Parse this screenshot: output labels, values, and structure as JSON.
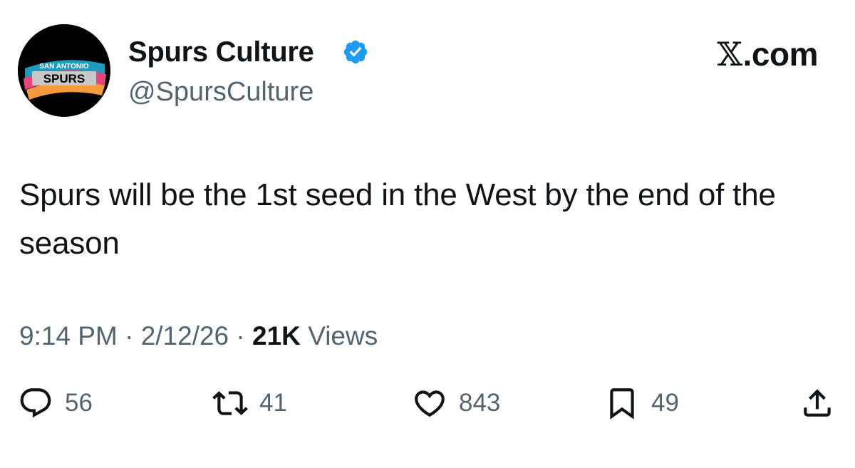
{
  "author": {
    "display_name": "Spurs Culture",
    "handle": "@SpursCulture",
    "verified": true,
    "avatar_logo_text_top": "SAN ANTONIO",
    "avatar_logo_text_main": "SPURS"
  },
  "site": {
    "glyph": "𝕏",
    "domain": ".com"
  },
  "tweet": {
    "text": "Spurs will be the 1st seed in the West by the end of the season",
    "time": "9:14 PM",
    "date": "2/12/26",
    "views_count": "21K",
    "views_label": "Views",
    "separator": "·"
  },
  "actions": {
    "replies": "56",
    "reposts": "41",
    "likes": "843",
    "bookmarks": "49"
  },
  "icons": {
    "verified": "verified-badge-icon",
    "reply": "reply-icon",
    "repost": "repost-icon",
    "like": "heart-icon",
    "bookmark": "bookmark-icon",
    "share": "share-icon"
  },
  "colors": {
    "text_primary": "#0f1419",
    "text_secondary": "#536471",
    "verified_blue": "#1d9bf0",
    "avatar_bg": "#000000",
    "logo_pink": "#e8457f",
    "logo_orange": "#f39a3c",
    "logo_teal": "#1f9bbb"
  }
}
